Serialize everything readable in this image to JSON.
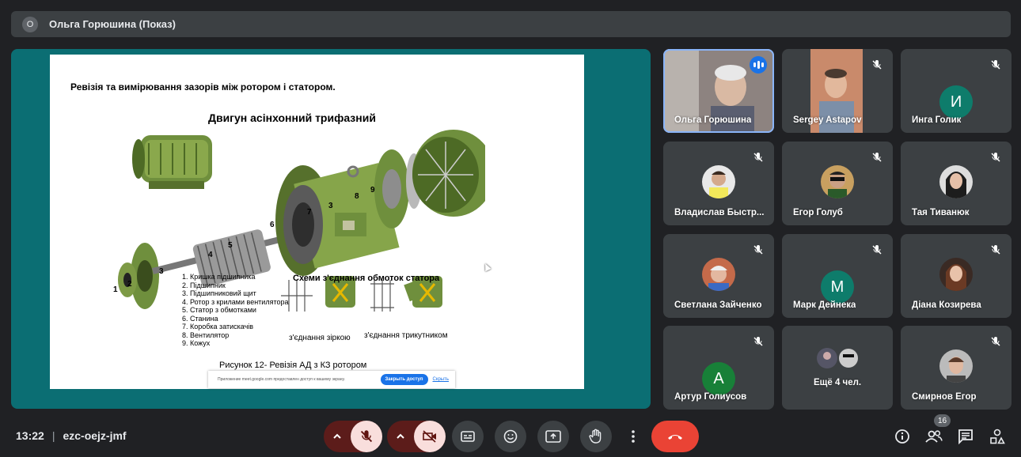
{
  "presenter_bar": {
    "avatar_letter": "О",
    "label": "Ольга Горюшина (Показ)"
  },
  "slide": {
    "heading": "Ревізія та  вимірювання зазорів між  ротором і статором.",
    "title": "Двигун асінхонний трифазний",
    "legend": [
      "1. Кришка підшипника",
      "2. Підшипник",
      "3. Підшипниковий щит",
      "4. Ротор з крилами вентилятора",
      "5. Статор з обмотками",
      "6. Станина",
      "7. Коробка затискачів",
      "8. Вентилятор",
      "9. Кожух"
    ],
    "part_numbers": [
      "1",
      "2",
      "3",
      "4",
      "5",
      "6",
      "7",
      "3",
      "8",
      "9"
    ],
    "schema_title": "Схеми з'єднання обмоток статора",
    "schema_star": "з'єднання зіркою",
    "schema_triangle": "з'єднання трикутником",
    "caption": "Рисунок 12- Ревізія АД з КЗ ротором"
  },
  "share_banner": {
    "message": "Приложение meet.google.com предоставлен доступ к вашему экрану.",
    "stop_label": "Закрыть доступ",
    "hide_label": "Скрыть"
  },
  "participants": [
    {
      "name": "Ольга Горюшина",
      "type": "video",
      "speaking": true
    },
    {
      "name": "Sergey Astapov",
      "type": "video"
    },
    {
      "name": "Инга Голик",
      "type": "letter",
      "letter": "И",
      "color": "#0e7c6b"
    },
    {
      "name": "Владислав Быстр...",
      "type": "photo"
    },
    {
      "name": "Егор Голуб",
      "type": "photo"
    },
    {
      "name": "Тая Тиванюк",
      "type": "photo"
    },
    {
      "name": "Светлана Зайченко",
      "type": "photo"
    },
    {
      "name": "Марк Дейнека",
      "type": "letter",
      "letter": "М",
      "color": "#0e7c6b"
    },
    {
      "name": "Діана Козирева",
      "type": "photo"
    },
    {
      "name": "Артур Голиусов",
      "type": "letter",
      "letter": "А",
      "color": "#188038"
    },
    {
      "name": "Ещё 4 чел.",
      "type": "more"
    },
    {
      "name": "Смирнов Егор",
      "type": "photo"
    }
  ],
  "meeting": {
    "time": "13:22",
    "code": "ezc-oejz-jmf"
  },
  "people_count": "16",
  "colors": {
    "background": "#202124",
    "tile": "#3c4043",
    "stage": "#0b6e73",
    "end_call": "#ea4335",
    "muted": "#f28b82"
  }
}
